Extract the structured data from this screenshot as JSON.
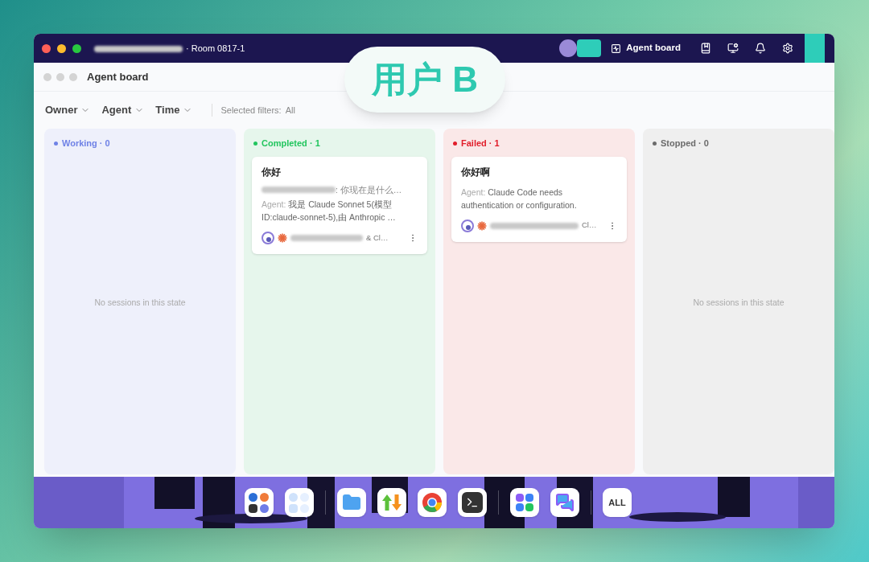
{
  "titlebar": {
    "room": "· Room 0817-1",
    "nav_label": "Agent board"
  },
  "badge": "用户 B",
  "board": {
    "title": "Agent board",
    "filters": [
      {
        "label": "Owner"
      },
      {
        "label": "Agent"
      },
      {
        "label": "Time"
      }
    ],
    "selected_filters_label": "Selected filters:",
    "selected_filters_value": "All"
  },
  "columns": [
    {
      "kind": "working",
      "name": "Working",
      "count": "· 0",
      "color": "#6f82e6",
      "empty_text": "No sessions in this state"
    },
    {
      "kind": "completed",
      "name": "Completed",
      "count": "· 1",
      "color": "#22c55e",
      "cards": [
        {
          "title": "你好",
          "user_message": ": 你现在是什么…",
          "agent_label": "Agent:",
          "agent_reply": "我是 Claude Sonnet 5(模型 ID:claude-sonnet-5),由 Anthropic …",
          "footer_text": "& Cl…"
        }
      ]
    },
    {
      "kind": "failed",
      "name": "Failed",
      "count": "· 1",
      "color": "#e11d2a",
      "cards": [
        {
          "title": "你好啊",
          "agent_label": "Agent:",
          "agent_reply": "Claude Code needs authentication or configuration.",
          "footer_text": "Cl…"
        }
      ]
    },
    {
      "kind": "stopped",
      "name": "Stopped",
      "count": "· 0",
      "color": "#6b6b6b",
      "empty_text": "No sessions in this state"
    }
  ],
  "dock": {
    "apps": [
      {
        "kind": "group"
      },
      {
        "kind": "group2"
      },
      {
        "kind": "files"
      },
      {
        "kind": "transfer"
      },
      {
        "kind": "browser"
      },
      {
        "kind": "terminal"
      },
      {
        "kind": "apps"
      },
      {
        "kind": "chat"
      },
      {
        "kind": "all",
        "label": "ALL"
      }
    ]
  }
}
